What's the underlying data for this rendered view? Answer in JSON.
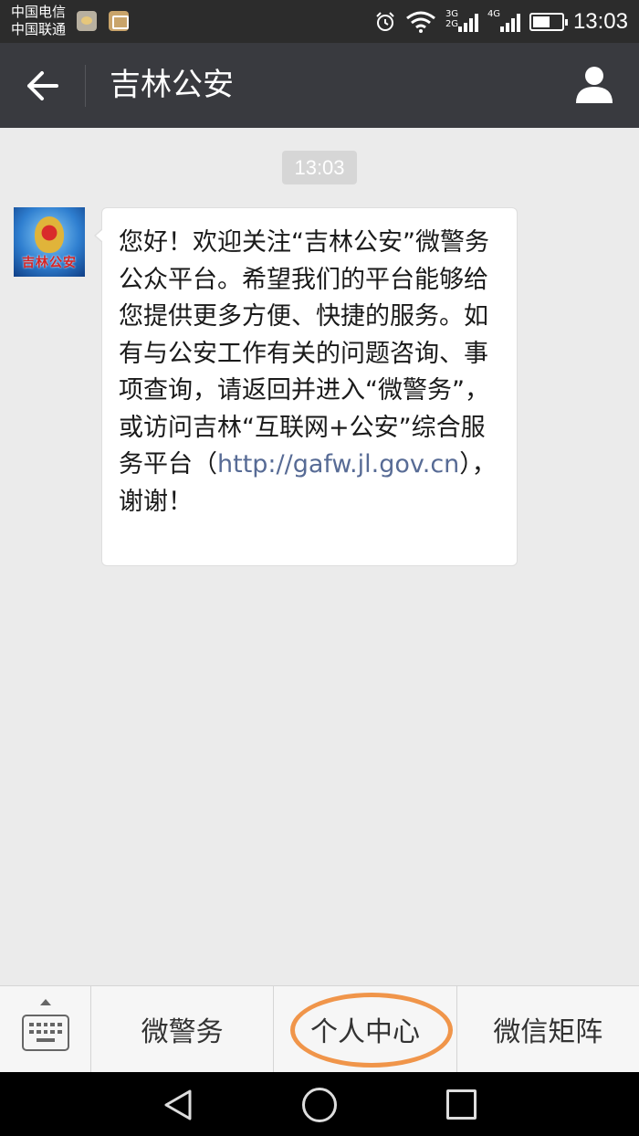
{
  "status_bar": {
    "carrier_1": "中国电信",
    "carrier_2": "中国联通",
    "network_label_1": "3G",
    "network_label_2": "2G",
    "network_label_3": "4G",
    "time": "13:03",
    "battery_level": 0.5
  },
  "app_bar": {
    "title": "吉林公安",
    "back_icon": "arrow-left-icon",
    "profile_icon": "person-icon"
  },
  "chat": {
    "timestamp": "13:03",
    "avatar_text": "吉林公安",
    "message": {
      "text_before_link": "您好！欢迎关注“吉林公安”微警务公众平台。希望我们的平台能够给您提供更多方便、快捷的服务。如有与公安工作有关的问题咨询、事项查询，请返回并进入“微警务”，或访问吉林“互联网+公安”综合服务平台（",
      "link": "http://gafw.jl.gov.cn",
      "text_after_link": "），谢谢！"
    }
  },
  "bottom_menu": {
    "items": [
      {
        "label": "微警务"
      },
      {
        "label": "个人中心"
      },
      {
        "label": "微信矩阵"
      }
    ],
    "highlight_color": "#f0954a"
  },
  "colors": {
    "app_bar": "#393a3f",
    "link": "#576b95",
    "background": "#ebebeb"
  }
}
